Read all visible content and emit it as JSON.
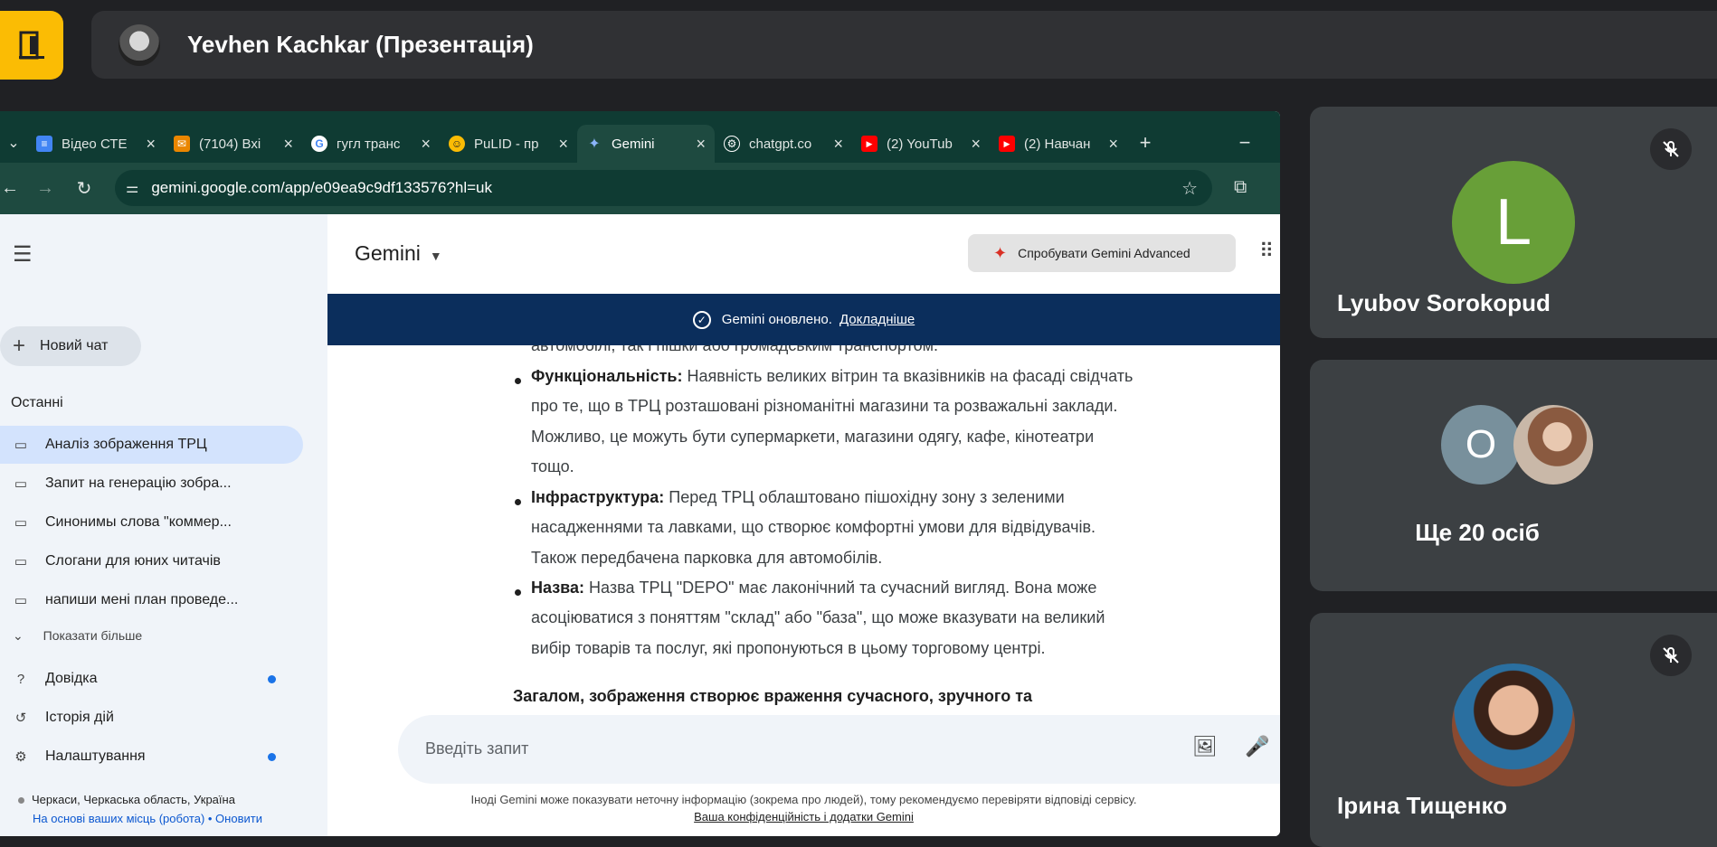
{
  "meet": {
    "presenter_name": "Yevhen Kachkar (Презентація)"
  },
  "browser": {
    "tabs": [
      {
        "label": "Відео СТЕ",
        "icon": "google-docs-icon",
        "color": "#4285f4"
      },
      {
        "label": "(7104) Вхі",
        "icon": "mail-icon",
        "color": "#ea8600"
      },
      {
        "label": "гугл транс",
        "icon": "google-icon",
        "color": "#ffffff"
      },
      {
        "label": "PuLID - пр",
        "icon": "face-emoji-icon",
        "color": "#fbbc04"
      },
      {
        "label": "Gemini",
        "icon": "gemini-spark-icon",
        "color": "#8ab4f8"
      },
      {
        "label": "chatgpt.co",
        "icon": "chatgpt-icon",
        "color": "#ffffff"
      },
      {
        "label": "(2) YouTub",
        "icon": "youtube-icon",
        "color": "#ff0000"
      },
      {
        "label": "(2) Навчан",
        "icon": "youtube-icon",
        "color": "#ff0000"
      }
    ],
    "url": "gemini.google.com/app/e09ea9c9df133576?hl=uk"
  },
  "gemini": {
    "title": "Gemini",
    "try_advanced": "Спробувати Gemini Advanced",
    "banner_text": "Gemini оновлено.",
    "banner_link": "Докладніше",
    "sidebar": {
      "new_chat": "Новий чат",
      "recent_heading": "Останні",
      "recent": [
        "Аналіз зображення ТРЦ",
        "Запит на генерацію зобра...",
        "Синонимы слова \"коммер...",
        "Слогани для юних читачів",
        "напиши мені план проведе..."
      ],
      "show_more": "Показати більше",
      "help": "Довідка",
      "history": "Історія дій",
      "settings": "Налаштування",
      "location": "Черкаси, Черкаська область, Україна",
      "location_source": "На основі ваших місць (робота) • Оновити"
    },
    "content": {
      "partial_top": "автомобілі, так і пішки або громадським транспортом.",
      "functional_label": "Функціональність:",
      "functional_1": " Наявність великих вітрин та вказівників на фасаді свідчать",
      "functional_2": "про те, що в ТРЦ розташовані різноманітні магазини та розважальні заклади.",
      "functional_3": "Можливо, це можуть бути супермаркети, магазини одягу, кафе, кінотеатри",
      "functional_4": "тощо.",
      "infra_label": "Інфраструктура:",
      "infra_1": " Перед ТРЦ облаштовано пішохідну зону з зеленими",
      "infra_2": "насадженнями та лавками, що створює комфортні умови для відвідувачів.",
      "infra_3": "Також передбачена парковка для автомобілів.",
      "name_label": "Назва:",
      "name_1": " Назва ТРЦ \"DEPO\" має лаконічний та сучасний вигляд. Вона може",
      "name_2": "асоціюватися з поняттям \"склад\" або \"база\", що може вказувати на великий",
      "name_3": "вибір товарів та послуг, які пропонуються в цьому торговому центрі.",
      "summary": "Загалом, зображення створює враження сучасного, зручного та"
    },
    "prompt_placeholder": "Введіть запит",
    "disclaimer": "Іноді Gemini може показувати неточну інформацію (зокрема про людей), тому рекомендуємо перевіряти відповіді сервісу.",
    "privacy": "Ваша конфіденційність і додатки Gemini"
  },
  "participants": {
    "p1": {
      "name": "Lyubov Sorokopud",
      "initial": "L",
      "color": "#689f38"
    },
    "group": {
      "label": "Ще 20 осіб",
      "initial": "O",
      "color": "#78909c"
    },
    "p3": {
      "name": "Ірина Тищенко"
    }
  }
}
